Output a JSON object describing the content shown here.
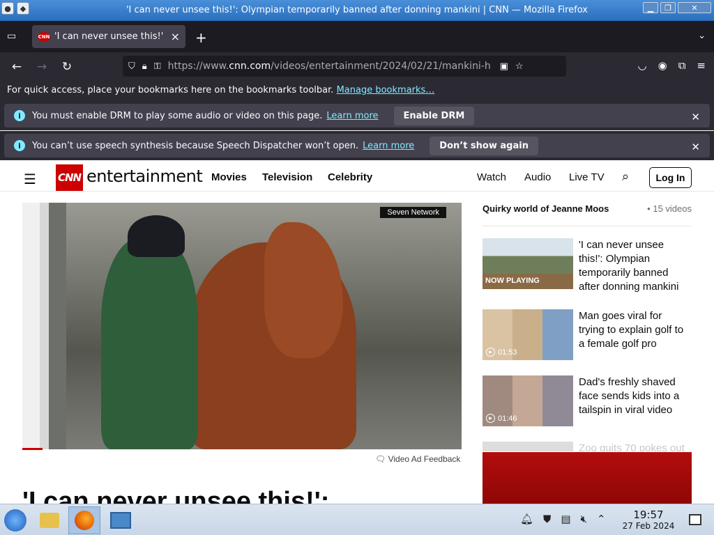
{
  "window": {
    "title": "'I can never unsee this!': Olympian temporarily banned after donning mankini | CNN — Mozilla Firefox"
  },
  "browser": {
    "tab_title": "'I can never unsee this!' ",
    "url_prefix": "https://www.",
    "url_domain": "cnn.com",
    "url_path": "/videos/entertainment/2024/02/21/mankini-h",
    "bookmarks_message": "For quick access, place your bookmarks here on the bookmarks toolbar.",
    "bookmarks_link": "Manage bookmarks…",
    "notifications": [
      {
        "message": "You must enable DRM to play some audio or video on this page.",
        "link": "Learn more",
        "button": "Enable DRM"
      },
      {
        "message": "You can’t use speech synthesis because Speech Dispatcher won’t open.",
        "link": "Learn more",
        "button": "Don’t show again"
      }
    ]
  },
  "cnn": {
    "logo": "CNN",
    "section": "entertainment",
    "nav_left": [
      "Movies",
      "Television",
      "Celebrity"
    ],
    "nav_right": [
      "Watch",
      "Audio",
      "Live TV"
    ],
    "login": "Log In",
    "video_badge": "Seven Network",
    "ad_feedback": "Video Ad Feedback",
    "headline": "'I can never unsee this!':",
    "playlist": {
      "title": "Quirky world of Jeanne Moos",
      "count": "15 videos",
      "items": [
        {
          "title": "'I can never unsee this!': Olympian temporarily banned after donning mankini",
          "label": "NOW PLAYING",
          "duration": ""
        },
        {
          "title": "Man goes viral for trying to explain golf to a female golf pro",
          "label": "",
          "duration": "01:53"
        },
        {
          "title": "Dad's freshly shaved face sends kids into a tailspin in viral video",
          "label": "",
          "duration": "01:46"
        },
        {
          "title": "Zoo quits 70 pokes out",
          "label": "",
          "duration": ""
        }
      ]
    }
  },
  "taskbar": {
    "time": "19:57",
    "date": "27 Feb 2024"
  },
  "colors": {
    "cnn_red": "#cc0000",
    "firefox_dark": "#1c1b22",
    "link_cyan": "#80ebff"
  }
}
